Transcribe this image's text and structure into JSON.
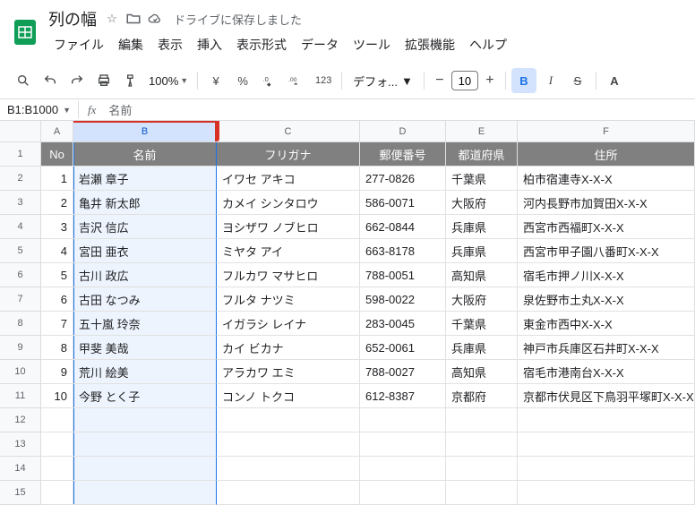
{
  "doc": {
    "title": "列の幅",
    "save_status": "ドライブに保存しました"
  },
  "menus": [
    "ファイル",
    "編集",
    "表示",
    "挿入",
    "表示形式",
    "データ",
    "ツール",
    "拡張機能",
    "ヘルプ"
  ],
  "toolbar": {
    "zoom": "100%",
    "currency_symbol": "¥",
    "percent": "%",
    "dec_dec": ".0",
    "num_fmt": "123",
    "font": "デフォ...",
    "font_size": "10",
    "bold": "B",
    "italic": "I",
    "strike": "S"
  },
  "formula": {
    "namebox": "B1:B1000",
    "fx": "fx",
    "value": "名前"
  },
  "columns": [
    "A",
    "B",
    "C",
    "D",
    "E",
    "F"
  ],
  "header_row": {
    "no": "No",
    "name": "名前",
    "furigana": "フリガナ",
    "postal": "郵便番号",
    "pref": "都道府県",
    "address": "住所"
  },
  "rows": [
    {
      "no": "1",
      "name": "岩瀬 章子",
      "furigana": "イワセ アキコ",
      "postal": "277-0826",
      "pref": "千葉県",
      "address": "柏市宿連寺X-X-X"
    },
    {
      "no": "2",
      "name": "亀井 新太郎",
      "furigana": "カメイ シンタロウ",
      "postal": "586-0071",
      "pref": "大阪府",
      "address": "河内長野市加賀田X-X-X"
    },
    {
      "no": "3",
      "name": "吉沢 信広",
      "furigana": "ヨシザワ ノブヒロ",
      "postal": "662-0844",
      "pref": "兵庫県",
      "address": "西宮市西福町X-X-X"
    },
    {
      "no": "4",
      "name": "宮田 亜衣",
      "furigana": "ミヤタ アイ",
      "postal": "663-8178",
      "pref": "兵庫県",
      "address": "西宮市甲子園八番町X-X-X"
    },
    {
      "no": "5",
      "name": "古川 政広",
      "furigana": "フルカワ マサヒロ",
      "postal": "788-0051",
      "pref": "高知県",
      "address": "宿毛市押ノ川X-X-X"
    },
    {
      "no": "6",
      "name": "古田 なつみ",
      "furigana": "フルタ ナツミ",
      "postal": "598-0022",
      "pref": "大阪府",
      "address": "泉佐野市土丸X-X-X"
    },
    {
      "no": "7",
      "name": "五十嵐 玲奈",
      "furigana": "イガラシ レイナ",
      "postal": "283-0045",
      "pref": "千葉県",
      "address": "東金市西中X-X-X"
    },
    {
      "no": "8",
      "name": "甲斐 美哉",
      "furigana": "カイ ビカナ",
      "postal": "652-0061",
      "pref": "兵庫県",
      "address": "神戸市兵庫区石井町X-X-X"
    },
    {
      "no": "9",
      "name": "荒川 絵美",
      "furigana": "アラカワ エミ",
      "postal": "788-0027",
      "pref": "高知県",
      "address": "宿毛市港南台X-X-X"
    },
    {
      "no": "10",
      "name": "今野 とく子",
      "furigana": "コンノ トクコ",
      "postal": "612-8387",
      "pref": "京都府",
      "address": "京都市伏見区下鳥羽平塚町X-X-X"
    }
  ],
  "empty_rows": [
    12,
    13,
    14,
    15
  ]
}
